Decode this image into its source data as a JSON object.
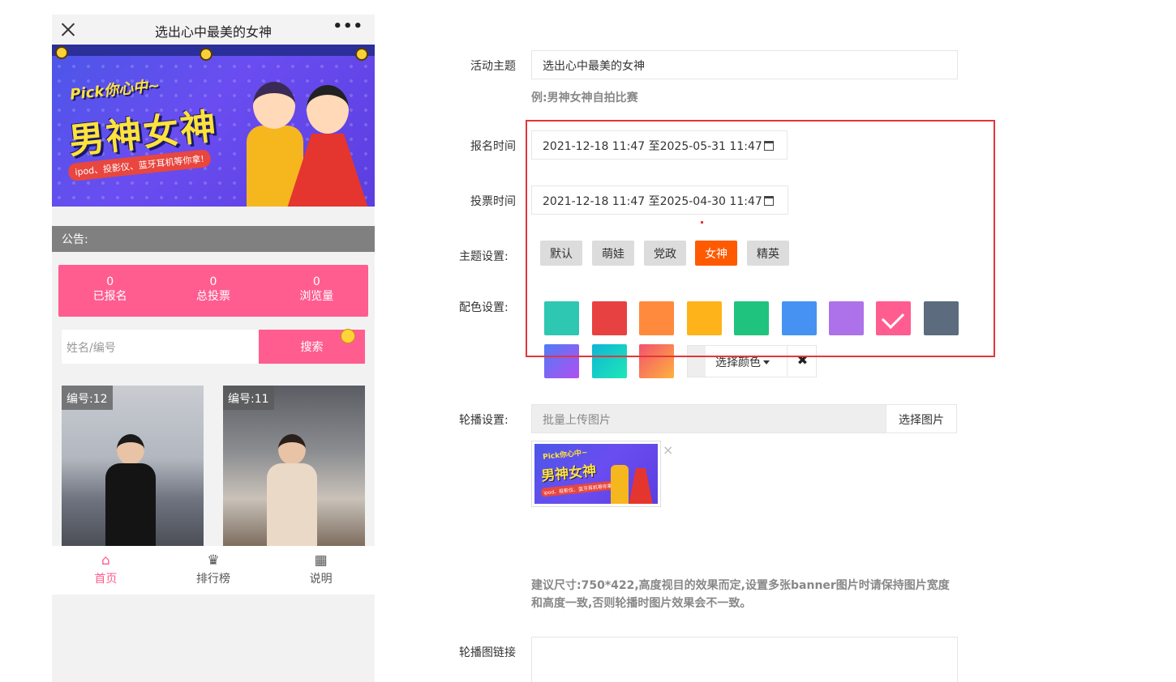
{
  "phone": {
    "title": "选出心中最美的女神",
    "more": "•••",
    "banner": {
      "pick_text": "Pick你心中~",
      "headline": "男神女神",
      "subline": "ipod、投影仪、蓝牙耳机等你拿!"
    },
    "notice_label": "公告:",
    "stats": [
      {
        "value": "0",
        "label": "已报名"
      },
      {
        "value": "0",
        "label": "总投票"
      },
      {
        "value": "0",
        "label": "浏览量"
      }
    ],
    "search": {
      "placeholder": "姓名/编号",
      "button": "搜索"
    },
    "cards": [
      {
        "label": "编号:12"
      },
      {
        "label": "编号:11"
      }
    ],
    "tabs": [
      {
        "icon": "home-icon",
        "label": "首页",
        "active": true
      },
      {
        "icon": "trophy-icon",
        "label": "排行榜",
        "active": false
      },
      {
        "icon": "calendar-icon",
        "label": "说明",
        "active": false
      }
    ]
  },
  "form": {
    "theme_topic": {
      "label": "活动主题",
      "value": "选出心中最美的女神",
      "hint": "例:男神女神自拍比赛"
    },
    "signup_time": {
      "label": "报名时间",
      "value": "2021-12-18 11:47 至2025-05-31 11:47"
    },
    "vote_time": {
      "label": "投票时间",
      "value": "2021-12-18 11:47 至2025-04-30 11:47"
    },
    "theme_settings": {
      "label": "主题设置:",
      "options": [
        "默认",
        "萌娃",
        "党政",
        "女神",
        "精英"
      ],
      "selected": "女神"
    },
    "color_settings": {
      "label": "配色设置:",
      "swatches": [
        "#2ec7b1",
        "#e84142",
        "#ff8a3d",
        "#ffb31a",
        "#1fc37d",
        "#4592f2",
        "#ad72ea",
        "#ff5d8f",
        "#5c6b7e"
      ],
      "selected_index": 7,
      "gradients": [
        [
          "#4f7cf7",
          "#b24ef0"
        ],
        [
          "#0fb5d6",
          "#1de8b5"
        ],
        [
          "#f2526e",
          "#ffb13d"
        ]
      ],
      "picker_label": "选择颜色",
      "clear": "✖"
    },
    "carousel": {
      "label": "轮播设置:",
      "placeholder": "批量上传图片",
      "button": "选择图片",
      "remove": "×",
      "advice": "建议尺寸:750*422,高度视目的效果而定,设置多张banner图片时请保持图片宽度和高度一致,否则轮播时图片效果会不一致。"
    },
    "carousel_link": {
      "label": "轮播图链接"
    }
  },
  "colors": {
    "accent_pink": "#ff5d8f",
    "theme_active": "#ff5a00",
    "highlight_box": "#e2363a"
  }
}
